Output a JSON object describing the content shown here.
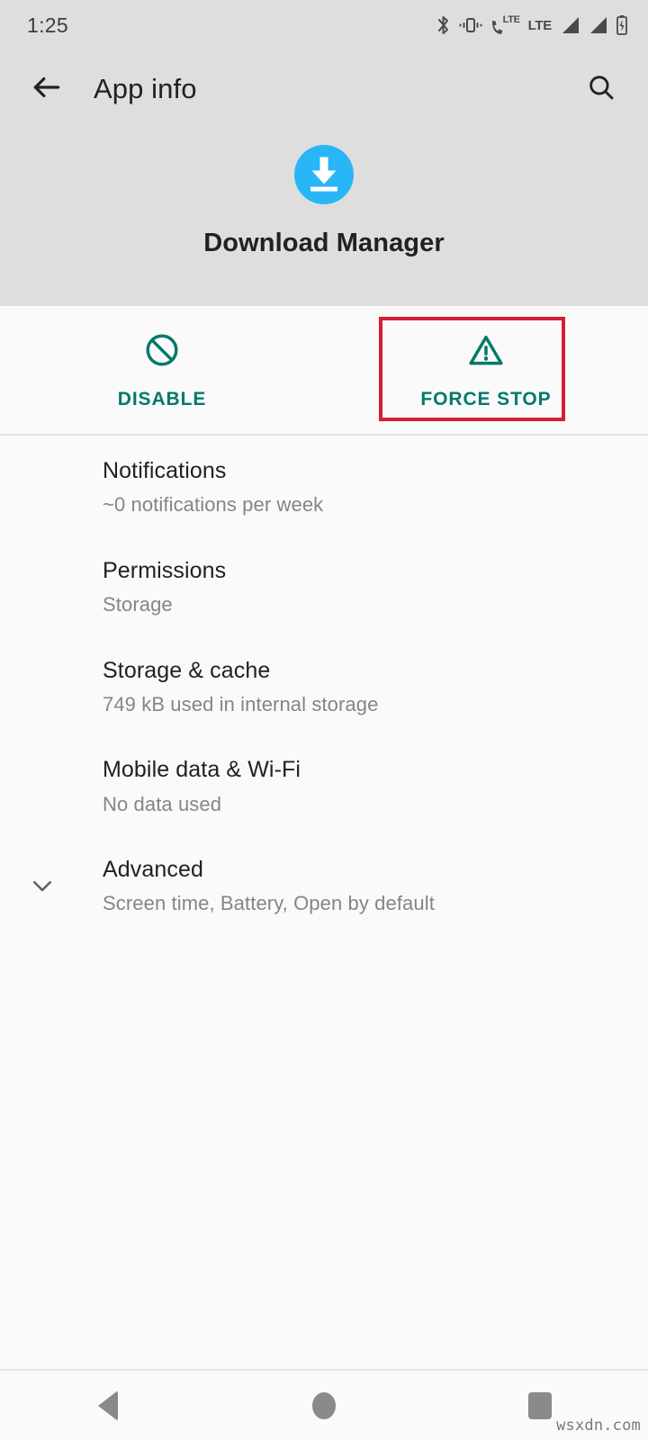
{
  "colors": {
    "header_bg": "#dedede",
    "page_bg": "#fafafa",
    "accent_teal": "#00796b",
    "annotation_red": "#d32030",
    "app_icon_blue": "#29b6f6",
    "primary_text": "#202124",
    "secondary_text": "#858585",
    "nav_icon": "#8a8a8a"
  },
  "status_bar": {
    "time": "1:25",
    "icons": [
      "bluetooth-icon",
      "vibrate-icon",
      "volte-icon",
      "lte-icon",
      "signal-bars-sim1-icon",
      "signal-bars-sim2-icon",
      "battery-charging-icon"
    ],
    "lte_label": "LTE"
  },
  "toolbar": {
    "back_icon": "back-arrow-icon",
    "title": "App info",
    "search_icon": "search-icon"
  },
  "app_identity": {
    "icon": "download-manager-icon",
    "name": "Download Manager"
  },
  "actions": [
    {
      "label": "DISABLE",
      "icon": "block-icon"
    },
    {
      "label": "FORCE STOP",
      "icon": "warning-triangle-icon"
    }
  ],
  "annotation": {
    "target": "FORCE STOP",
    "color": "#d32030"
  },
  "settings": [
    {
      "title": "Notifications",
      "subtitle": "~0 notifications per week",
      "expandable": false
    },
    {
      "title": "Permissions",
      "subtitle": "Storage",
      "expandable": false
    },
    {
      "title": "Storage & cache",
      "subtitle": "749 kB used in internal storage",
      "expandable": false
    },
    {
      "title": "Mobile data & Wi-Fi",
      "subtitle": "No data used",
      "expandable": false
    },
    {
      "title": "Advanced",
      "subtitle": "Screen time, Battery, Open by default",
      "expandable": true,
      "expand_icon": "chevron-down-icon"
    }
  ],
  "navbar": [
    {
      "name": "back",
      "icon": "nav-back-icon"
    },
    {
      "name": "home",
      "icon": "nav-home-icon"
    },
    {
      "name": "recents",
      "icon": "nav-recents-icon"
    }
  ],
  "watermark": "wsxdn.com"
}
